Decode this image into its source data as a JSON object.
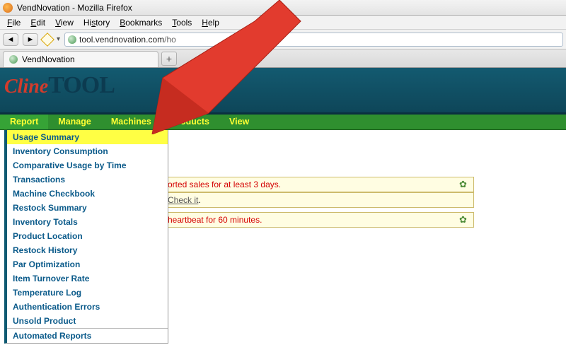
{
  "window": {
    "title": "VendNovation - Mozilla Firefox"
  },
  "menubar": {
    "file": "File",
    "edit": "Edit",
    "view": "View",
    "history": "History",
    "bookmarks": "Bookmarks",
    "tools": "Tools",
    "help": "Help"
  },
  "url": {
    "host": "tool.vendnovation.com",
    "path": "/ho"
  },
  "tab": {
    "title": "VendNovation"
  },
  "logo": {
    "part1": "Cline",
    "part2": "TOOL"
  },
  "nav": {
    "items": [
      "Report",
      "Manage",
      "Machines",
      "Products",
      "View"
    ],
    "activeIndex": 0
  },
  "dropdown": {
    "highlightIndex": 0,
    "items": [
      "Usage Summary",
      "Inventory Consumption",
      "Comparative Usage by Time",
      "Transactions",
      "Machine Checkbook",
      "Restock Summary",
      "Inventory Totals",
      "Product Location",
      "Restock History",
      "Par Optimization",
      "Item Turnover Rate",
      "Temperature Log",
      "Authentication Errors",
      "Unsold Product"
    ],
    "footer": "Automated Reports"
  },
  "alerts": {
    "a1": "orted sales for at least 3 days.",
    "a2_pre": "Check it",
    "a2_post": ".",
    "a3": " heartbeat for 60 minutes."
  }
}
